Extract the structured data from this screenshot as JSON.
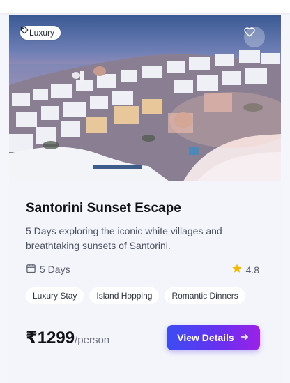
{
  "card": {
    "badge_label": "Luxury",
    "title": "Santorini Sunset Escape",
    "description": "5 Days exploring the iconic white villages and breathtaking sunsets of Santorini.",
    "duration": "5 Days",
    "rating": "4.8",
    "tags": [
      "Luxury Stay",
      "Island Hopping",
      "Romantic Dinners"
    ],
    "price": "₹1299",
    "price_unit": "/person",
    "cta_label": "View Details"
  },
  "icons": {
    "badge": "tag-icon",
    "favorite": "heart-icon",
    "duration": "calendar-icon",
    "rating": "star-icon",
    "cta": "arrow-right-icon"
  },
  "colors": {
    "star": "#f5b800",
    "cta_start": "#3b4df2",
    "cta_end": "#9a22e6",
    "title": "#111318"
  }
}
